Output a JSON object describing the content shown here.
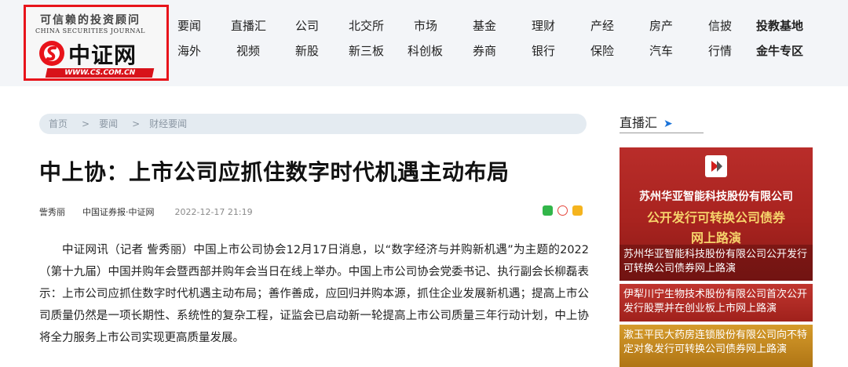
{
  "logo": {
    "slogan": "可信赖的投资顾问",
    "journal": "CHINA SECURITIES JOURNAL",
    "name": "中证网",
    "url": "WWW.CS.COM.CN",
    "brand_color": "#e8141b"
  },
  "nav": {
    "row1": [
      "要闻",
      "直播汇",
      "公司",
      "北交所",
      "市场",
      "基金",
      "理财",
      "产经",
      "房产",
      "信披",
      "投教基地"
    ],
    "row2": [
      "海外",
      "视频",
      "新股",
      "新三板",
      "科创板",
      "券商",
      "银行",
      "保险",
      "汽车",
      "行情",
      "金牛专区"
    ]
  },
  "breadcrumb": {
    "home": "首页",
    "sep": ">",
    "level1": "要闻",
    "level2": "财经要闻"
  },
  "article": {
    "title": "中上协：上市公司应抓住数字时代机遇主动布局",
    "author": "訾秀丽",
    "source": "中国证券报·中证网",
    "time": "2022-12-17 21:19",
    "share_icons": [
      "wechat-icon",
      "weibo-icon",
      "qzone-icon"
    ],
    "body": "中证网讯（记者 訾秀丽）中国上市公司协会12月17日消息，以“数字经济与并购新机遇”为主题的2022（第十九届）中国并购年会暨西部并购年会当日在线上举办。中国上市公司协会党委书记、执行副会长柳磊表示：上市公司应抓住数字时代机遇主动布局；善作善成，应回归并购本源，抓住企业发展新机遇；提高上市公司质量仍然是一项长期性、系统性的复杂工程，证监会已启动新一轮提高上市公司质量三年行动计划，中上协将全力服务上市公司实现更高质量发展。"
  },
  "live": {
    "heading": "直播汇",
    "arrow": "➤",
    "cards": [
      {
        "banner_title": "苏州华亚智能科技股份有限公司",
        "banner_sub": "公开发行可转换公司债券",
        "banner_sub2": "网上路演",
        "caption": "苏州华亚智能科技股份有限公司公开发行可转换公司债券网上路演"
      },
      {
        "caption": "伊犁川宁生物技术股份有限公司首次公开发行股票并在创业板上市网上路演"
      },
      {
        "caption": "漱玉平民大药房连锁股份有限公司向不特定对象发行可转换公司债券网上路演"
      }
    ]
  }
}
